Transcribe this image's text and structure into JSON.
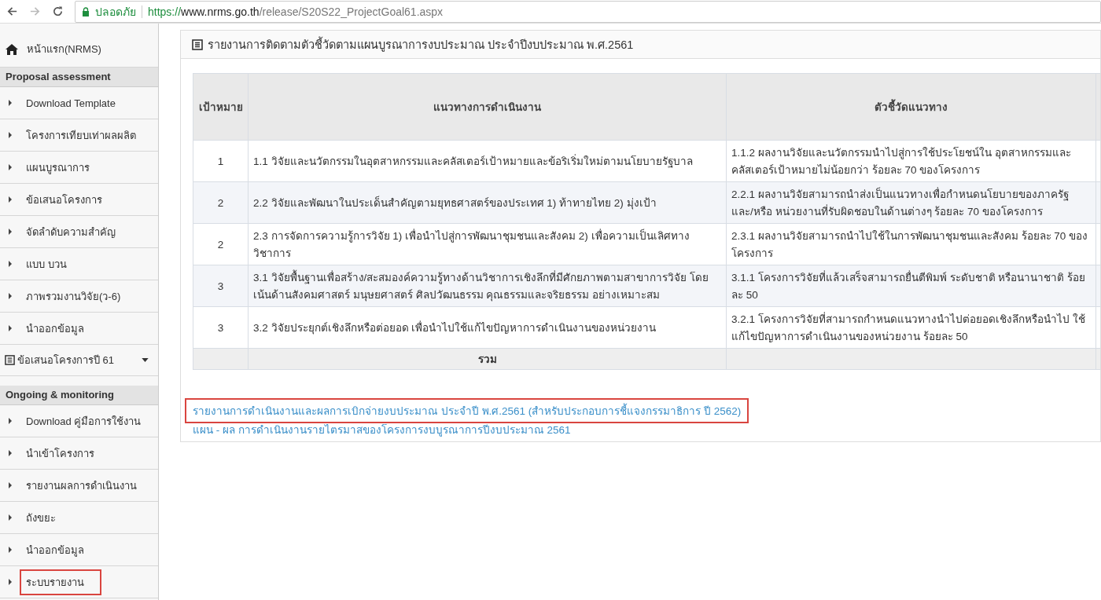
{
  "browser": {
    "security_label": "ปลอดภัย",
    "url_parts": [
      {
        "text": "https://",
        "kind": "scheme"
      },
      {
        "text": "www.nrms.go.th",
        "kind": "host"
      },
      {
        "text": "/release/S20S22_ProjectGoal61.aspx",
        "kind": "path"
      }
    ]
  },
  "sidebar": {
    "items": [
      {
        "kind": "home",
        "label": "หน้าแรก(NRMS)"
      },
      {
        "kind": "section",
        "label": "Proposal assessment"
      },
      {
        "kind": "link",
        "label": "Download Template",
        "highlighted": false
      },
      {
        "kind": "link",
        "label": "โครงการเทียบเท่าผลผลิต",
        "highlighted": false
      },
      {
        "kind": "link",
        "label": "แผนบูรณาการ",
        "highlighted": false
      },
      {
        "kind": "link",
        "label": "ข้อเสนอโครงการ",
        "highlighted": false
      },
      {
        "kind": "link",
        "label": "จัดลำดับความสำคัญ",
        "highlighted": false
      },
      {
        "kind": "link",
        "label": "แบบ บวน",
        "highlighted": false
      },
      {
        "kind": "link",
        "label": "ภาพรวมงานวิจัย(ว-6)",
        "highlighted": false
      },
      {
        "kind": "link",
        "label": "นำออกข้อมูล",
        "highlighted": false
      },
      {
        "kind": "dropdown",
        "label": "ข้อเสนอโครงการปี 61"
      },
      {
        "kind": "section",
        "label": "Ongoing & monitoring"
      },
      {
        "kind": "link",
        "label": "Download คู่มือการใช้งาน",
        "highlighted": false
      },
      {
        "kind": "link",
        "label": "นำเข้าโครงการ",
        "highlighted": false
      },
      {
        "kind": "link",
        "label": "รายงานผลการดำเนินงาน",
        "highlighted": false
      },
      {
        "kind": "link",
        "label": "ถังขยะ",
        "highlighted": false
      },
      {
        "kind": "link",
        "label": "นำออกข้อมูล",
        "highlighted": false
      },
      {
        "kind": "link",
        "label": "ระบบรายงาน",
        "highlighted": true
      }
    ]
  },
  "panel": {
    "title": "รายงานการติดตามตัวชี้วัดตามแผนบูรณาการงบประมาณ ประจำปีงบประมาณ พ.ศ.2561",
    "table": {
      "columns": [
        "เป้าหมาย",
        "แนวทางการดำเนินงาน",
        "ตัวชี้วัดแนวทาง"
      ],
      "rows": [
        [
          "1",
          "1.1 วิจัยและนวัตกรรมในอุตสาหกรรมและคลัสเตอร์เป้าหมายและข้อริเริ่มใหม่ตามนโยบายรัฐบาล",
          "1.1.2 ผลงานวิจัยและนวัตกรรมนำไปสู่การใช้ประโยชน์ใน อุตสาหกรรมและคลัสเตอร์เป้าหมายไม่น้อยกว่า ร้อยละ 70 ของโครงการ"
        ],
        [
          "2",
          "2.2 วิจัยและพัฒนาในประเด็นสำคัญตามยุทธศาสตร์ของประเทศ 1) ท้าทายไทย 2) มุ่งเป้า",
          "2.2.1 ผลงานวิจัยสามารถนำส่งเป็นแนวทางเพื่อกำหนดนโยบายของภาครัฐ และ/หรือ หน่วยงานที่รับผิดชอบในด้านต่างๆ ร้อยละ 70 ของโครงการ"
        ],
        [
          "2",
          "2.3 การจัดการความรู้การวิจัย 1) เพื่อนำไปสู่การพัฒนาชุมชนและสังคม 2) เพื่อความเป็นเลิศทาง วิชาการ",
          "2.3.1 ผลงานวิจัยสามารถนำไปใช้ในการพัฒนาชุมชนและสังคม ร้อยละ 70 ของโครงการ"
        ],
        [
          "3",
          "3.1 วิจัยพื้นฐานเพื่อสร้าง/สะสมองค์ความรู้ทางด้านวิชาการเชิงลึกที่มีศักยภาพตามสาขาการวิจัย โดยเน้นด้านสังคมศาสตร์ มนุษยศาสตร์ ศิลปวัฒนธรรม คุณธรรมและจริยธรรม อย่างเหมาะสม",
          "3.1.1 โครงการวิจัยที่แล้วเสร็จสามารถยื่นตีพิมพ์ ระดับชาติ หรือนานาชาติ ร้อยละ 50"
        ],
        [
          "3",
          "3.2 วิจัยประยุกต์เชิงลึกหรือต่อยอด เพื่อนำไปใช้แก้ไขปัญหาการดำเนินงานของหน่วยงาน",
          "3.2.1 โครงการวิจัยที่สามารถกำหนดแนวทางนำไปต่อยอดเชิงลึกหรือนำไป ใช้แก้ไขปัญหาการดำเนินงานของหน่วยงาน ร้อยละ 50"
        ]
      ],
      "total_label": "รวม"
    },
    "links": [
      {
        "label": "รายงานการดำเนินงานและผลการเบิกจ่ายงบประมาณ ประจำปี พ.ศ.2561 (สำหรับประกอบการชี้แจงกรรมาธิการ ปี 2562)",
        "highlighted": true
      },
      {
        "label": "แผน - ผล การดำเนินงานรายไตรมาสของโครงการงบบูรณาการปีงบประมาณ 2561",
        "highlighted": false
      }
    ]
  }
}
